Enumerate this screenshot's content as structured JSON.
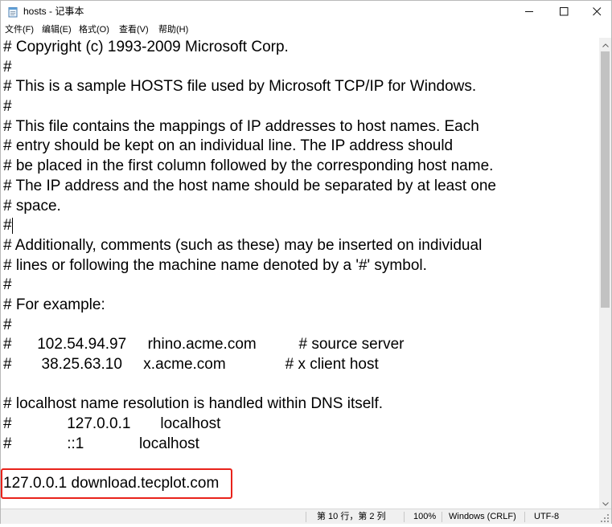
{
  "window": {
    "title": "hosts - 记事本",
    "icon": "notepad-icon",
    "controls": [
      "minimize-icon",
      "maximize-icon",
      "close-icon"
    ]
  },
  "menu": {
    "file": "文件(F)",
    "edit": "编辑(E)",
    "format": "格式(O)",
    "view": "查看(V)",
    "help": "帮助(H)"
  },
  "editor": {
    "lines": [
      "# Copyright (c) 1993-2009 Microsoft Corp.",
      "#",
      "# This is a sample HOSTS file used by Microsoft TCP/IP for Windows.",
      "#",
      "# This file contains the mappings of IP addresses to host names. Each",
      "# entry should be kept on an individual line. The IP address should",
      "# be placed in the first column followed by the corresponding host name.",
      "# The IP address and the host name should be separated by at least one",
      "# space.",
      "#",
      "# Additionally, comments (such as these) may be inserted on individual",
      "# lines or following the machine name denoted by a '#' symbol.",
      "#",
      "# For example:",
      "#",
      "#      102.54.94.97     rhino.acme.com          # source server",
      "#       38.25.63.10     x.acme.com              # x client host",
      "",
      "# localhost name resolution is handled within DNS itself.",
      "#             127.0.0.1       localhost",
      "#             ::1             localhost",
      "",
      "127.0.0.1 download.tecplot.com"
    ],
    "highlight_color": "#e8231b"
  },
  "status": {
    "position": "第 10 行，第 2 列",
    "zoom": "100%",
    "line_ending": "Windows (CRLF)",
    "encoding": "UTF-8"
  }
}
